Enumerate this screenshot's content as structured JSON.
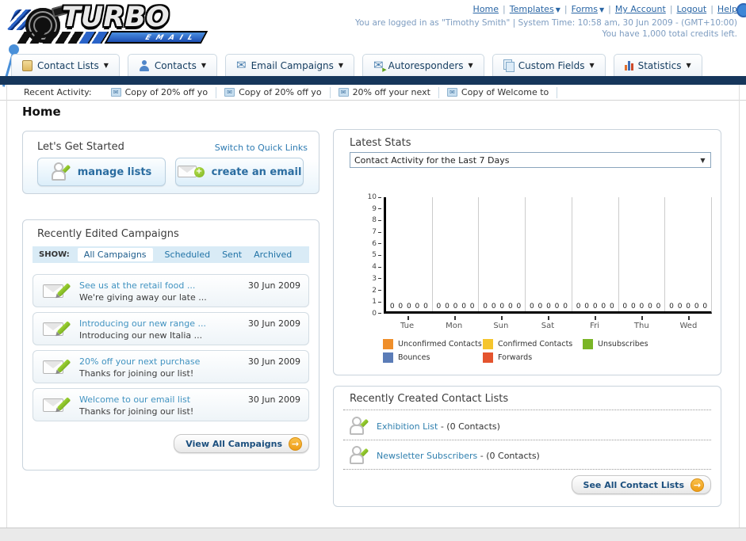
{
  "header": {
    "logo": {
      "title": "TURBO",
      "subtitle": "EMAIL"
    },
    "links": [
      {
        "label": "Home",
        "dropdown": false
      },
      {
        "label": "Templates",
        "dropdown": true
      },
      {
        "label": "Forms",
        "dropdown": true
      },
      {
        "label": "My Account",
        "dropdown": false
      },
      {
        "label": "Logout",
        "dropdown": false
      },
      {
        "label": "Help",
        "dropdown": false
      }
    ],
    "login_info": "You are logged in as \"Timothy Smith\" | System Time: 10:58 am, 30 Jun 2009 - (GMT+10:00)",
    "credits_info": "You have 1,000 total credits left."
  },
  "nav_tabs": [
    {
      "label": "Contact Lists",
      "icon": "contact-lists-icon"
    },
    {
      "label": "Contacts",
      "icon": "contacts-icon"
    },
    {
      "label": "Email Campaigns",
      "icon": "email-campaigns-icon"
    },
    {
      "label": "Autoresponders",
      "icon": "autoresponders-icon"
    },
    {
      "label": "Custom Fields",
      "icon": "custom-fields-icon"
    },
    {
      "label": "Statistics",
      "icon": "statistics-icon"
    }
  ],
  "recent_activity": {
    "label": "Recent Activity:",
    "items": [
      "Copy of 20% off yo",
      "Copy of 20% off yo",
      "20% off your next",
      "Copy of Welcome to"
    ]
  },
  "page_title": "Home",
  "get_started": {
    "title": "Let's Get Started",
    "switch_link": "Switch to Quick Links",
    "manage_lists_label": "manage lists",
    "create_email_label": "create an email"
  },
  "campaigns": {
    "title": "Recently Edited Campaigns",
    "show_label": "SHOW:",
    "filters": [
      "All Campaigns",
      "Scheduled",
      "Sent",
      "Archived"
    ],
    "active_filter": "All Campaigns",
    "items": [
      {
        "title": "See us at the retail food ...",
        "subtitle": "We're giving away our late ...",
        "date": "30 Jun 2009"
      },
      {
        "title": "Introducing our new range ...",
        "subtitle": "Introducing our new Italia ...",
        "date": "30 Jun 2009"
      },
      {
        "title": "20% off your next purchase",
        "subtitle": "Thanks for joining our list!",
        "date": "30 Jun 2009"
      },
      {
        "title": "Welcome to our email list",
        "subtitle": "Thanks for joining our list!",
        "date": "30 Jun 2009"
      }
    ],
    "view_all_label": "View All Campaigns"
  },
  "stats": {
    "title": "Latest Stats",
    "dropdown_value": "Contact Activity for the Last 7 Days"
  },
  "chart_data": {
    "type": "bar",
    "title": "Contact Activity for the Last 7 Days",
    "categories": [
      "Tue",
      "Mon",
      "Sun",
      "Sat",
      "Fri",
      "Thu",
      "Wed"
    ],
    "series": [
      {
        "name": "Unconfirmed Contacts",
        "color": "#ef8e2a",
        "values": [
          0,
          0,
          0,
          0,
          0,
          0,
          0
        ]
      },
      {
        "name": "Confirmed Contacts",
        "color": "#f5c52d",
        "values": [
          0,
          0,
          0,
          0,
          0,
          0,
          0
        ]
      },
      {
        "name": "Unsubscribes",
        "color": "#7ab526",
        "values": [
          0,
          0,
          0,
          0,
          0,
          0,
          0
        ]
      },
      {
        "name": "Bounces",
        "color": "#5b7cb7",
        "values": [
          0,
          0,
          0,
          0,
          0,
          0,
          0
        ]
      },
      {
        "name": "Forwards",
        "color": "#e4542e",
        "values": [
          0,
          0,
          0,
          0,
          0,
          0,
          0
        ]
      }
    ],
    "ylim": [
      0,
      10
    ],
    "ytick_step": 1,
    "xlabel": "",
    "ylabel": "",
    "grid": "vertical-day-separators",
    "legend_position": "bottom",
    "value_labels": "0 shown for every series on every day"
  },
  "contact_lists": {
    "title": "Recently Created Contact Lists",
    "separator": " - ",
    "items": [
      {
        "name": "Exhibition List",
        "count": "(0 Contacts)"
      },
      {
        "name": "Newsletter Subscribers",
        "count": "(0 Contacts)"
      }
    ],
    "see_all_label": "See All Contact Lists"
  },
  "colors": {
    "navy_bar": "#16365b",
    "link_blue": "#2a66a5",
    "campaign_link_blue": "#4193c1",
    "go_arrow_orange": "#ee9d17"
  }
}
